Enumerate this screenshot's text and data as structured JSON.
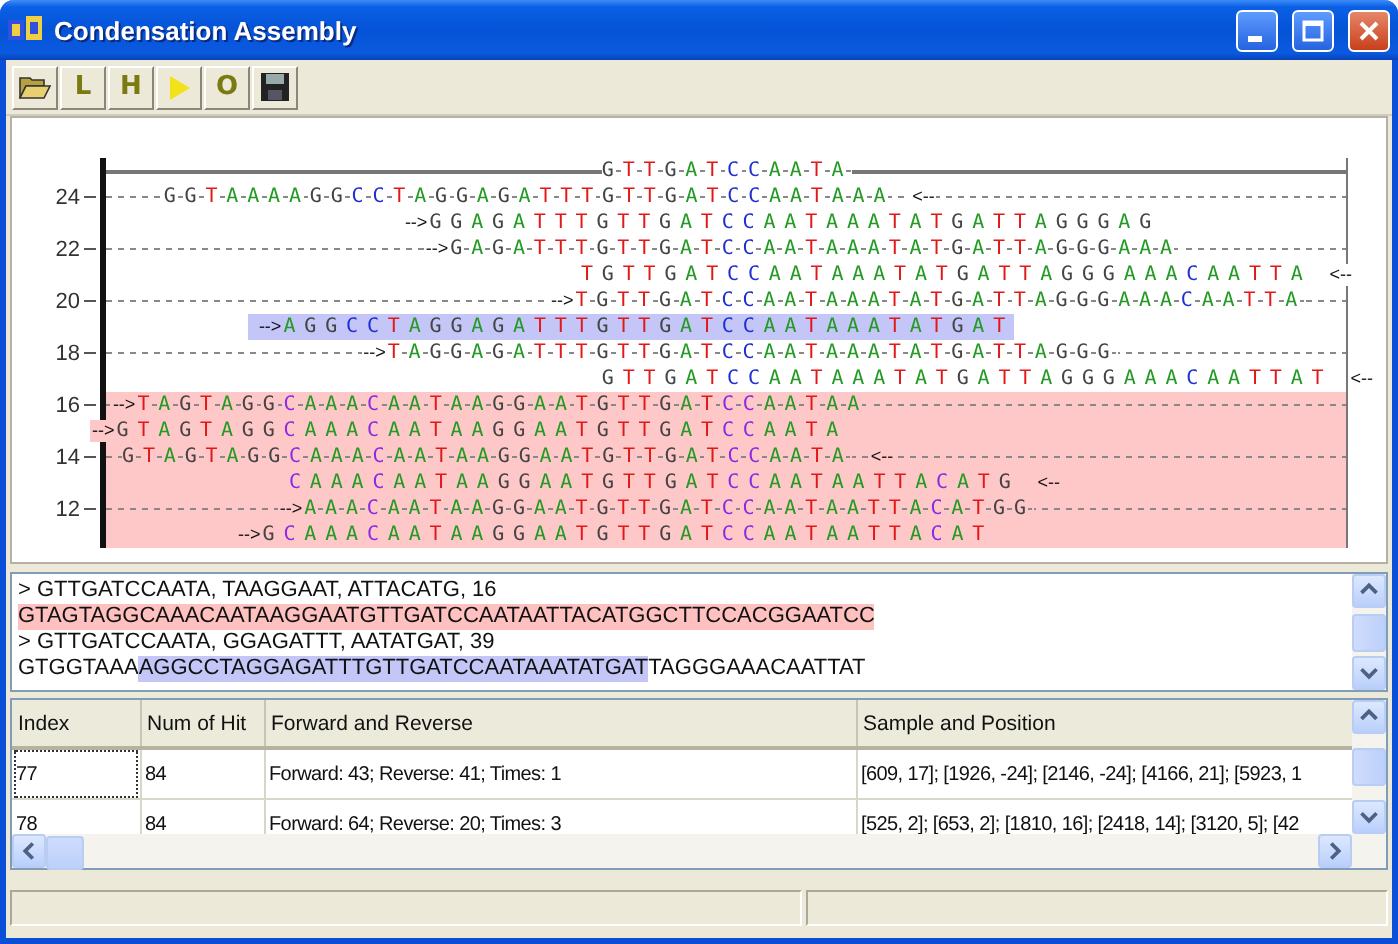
{
  "window": {
    "title": "Condensation Assembly"
  },
  "toolbar": [
    {
      "kind": "open"
    },
    {
      "kind": "letter",
      "label": "L"
    },
    {
      "kind": "letter",
      "label": "H"
    },
    {
      "kind": "play"
    },
    {
      "kind": "letter",
      "label": "O"
    },
    {
      "kind": "save"
    }
  ],
  "alignment": {
    "rows": [
      {
        "kind": "consensus",
        "sequence": "                       GTTGATCCAATA",
        "dashed": true
      },
      {
        "kind": "read",
        "label": "24",
        "sequence": "  GGTAAAAGGCCTAGGAGATTTGTTGATCCAATAAA",
        "dashed": true,
        "suffix": "<--"
      },
      {
        "kind": "read",
        "sequence": "               GGAGATTTGTTGATCCAATAAATATGATTAGGGAG",
        "dashed": false,
        "prefix": "-->"
      },
      {
        "kind": "read",
        "label": "22",
        "sequence": "                GAGATTTGTTGATCCAATAAATATGATTAGGGAAA",
        "dashed": true,
        "prefix": "-->"
      },
      {
        "kind": "read",
        "sequence": "                      TGTTGATCCAATAAATATGATTAGGGAAACAATTA",
        "dashed": false,
        "suffix": "<--"
      },
      {
        "kind": "read",
        "label": "20",
        "sequence": "                      TGTTGATCCAATAAATATGATTAGGGAAACAATTA",
        "dashed": true,
        "prefix": "-->"
      },
      {
        "kind": "read",
        "sequence": "        AGGCCTAGGAGATTTGTTGATCCAATAAATATGAT",
        "dashed": false,
        "color": "#c4c6f8",
        "prefix": "-->"
      },
      {
        "kind": "read",
        "label": "18",
        "sequence": "             TAGGAGATTTGTTGATCCAATAAATATGATTAGGG",
        "dashed": true,
        "prefix": "-->"
      },
      {
        "kind": "read",
        "sequence": "                       GTTGATCCAATAAATATGATTAGGGAAACAATTAT",
        "dashed": false,
        "suffix": "<--"
      },
      {
        "kind": "read",
        "label": "16",
        "sequence": " TAGTAGGCAAACAATAAGGAATGTTGATCCAATAA",
        "dashed": true,
        "color": "#ffc8c8",
        "prefix": "-->"
      },
      {
        "kind": "read",
        "sequence": "GTAGTAGGCAAACAATAAGGAATGTTGATCCAATA",
        "dashed": false,
        "color": "#ffc8c8",
        "prefix": "-->"
      },
      {
        "kind": "read",
        "label": "14",
        "sequence": "GTAGTAGGCAAACAATAAGGAATGTTGATCCAATA",
        "dashed": true,
        "color": "#ffc8c8",
        "suffix": "<--"
      },
      {
        "kind": "read",
        "sequence": "        CAAACAATAAGGAATGTTGATCCAATAATTACATG",
        "dashed": false,
        "color": "#ffc8c8",
        "suffix": "<--"
      },
      {
        "kind": "read",
        "label": "12",
        "sequence": "         AAACAATAAGGAATGTTGATCCAATAATTACATGG",
        "dashed": true,
        "color": "#ffc8c8",
        "prefix": "-->"
      },
      {
        "kind": "read",
        "sequence": "       GCAAACAATAAGGAATGTTGATCCAATAATTACAT",
        "dashed": false,
        "color": "#ffc8c8",
        "prefix": "-->"
      }
    ]
  },
  "details": {
    "lines": [
      {
        "segments": [
          {
            "text": "> GTTGATCCAATA, TAAGGAAT, ATTACATG, 16"
          }
        ]
      },
      {
        "segments": [
          {
            "text": "GTAGTAGGCAAACAATAAGGAATGTTGATCCAATAATTACATGGCTTCCACGGAATCC",
            "color": "#ffc0c0"
          }
        ]
      },
      {
        "segments": [
          {
            "text": "> GTTGATCCAATA, GGAGATTT, AATATGAT, 39"
          }
        ]
      },
      {
        "segments": [
          {
            "text": "GTGGTAAA"
          },
          {
            "text": "AGGCCTAGGAGATTTGTTGATCCAATAAATATGAT",
            "color": "#c4c6f8"
          },
          {
            "text": "TAGGGAAACAATTAT"
          }
        ]
      }
    ]
  },
  "table": {
    "columns": [
      "Index",
      "Num of Hit",
      "Forward and Reverse",
      "Sample and Position"
    ],
    "rows": [
      {
        "focused": true,
        "cells": [
          "77",
          "84",
          "Forward: 43; Reverse: 41; Times: 1",
          "[609, 17]; [1926, -24]; [2146, -24]; [4166, 21]; [5923, 1"
        ]
      },
      {
        "focused": false,
        "cells": [
          "78",
          "84",
          "Forward: 64; Reverse: 20; Times: 3",
          "[525, 2]; [653, 2]; [1810, 16]; [2418, 14]; [3120, 5]; [42"
        ]
      }
    ]
  }
}
